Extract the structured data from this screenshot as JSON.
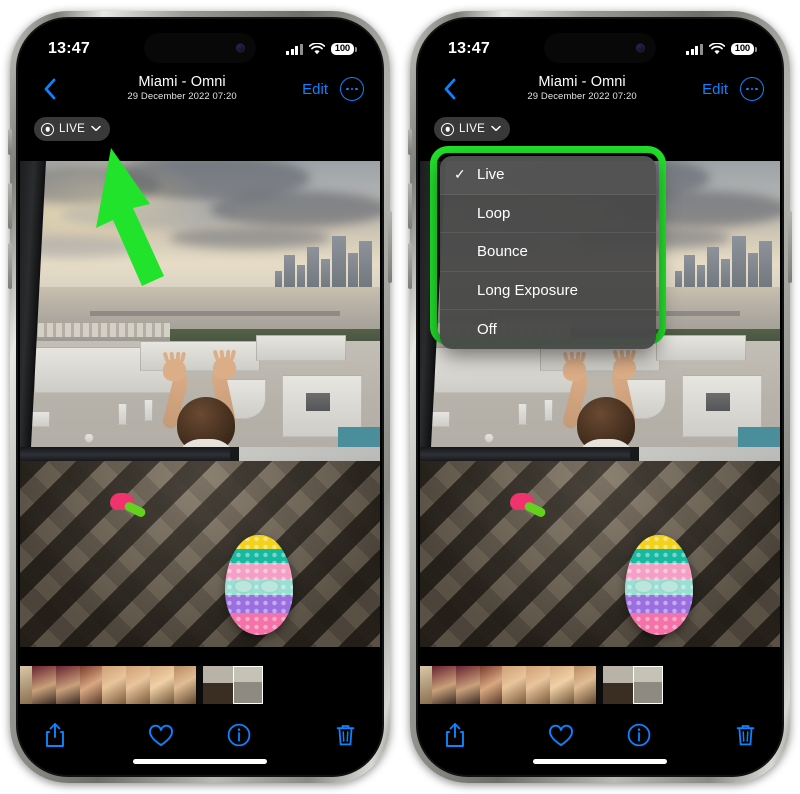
{
  "meta": {
    "description": "Two iPhone screenshots of the Photos app showing a Live Photo with the LIVE effects menu closed (left) and open (right)",
    "accent_blue": "#0a84ff",
    "highlight_green": "#22e32b",
    "menu_background": "#484848"
  },
  "phones": [
    {
      "id": "left",
      "status_bar": {
        "time": "13:47",
        "signal_icon": "cellular-bars-icon",
        "wifi_icon": "wifi-icon",
        "battery": "100"
      },
      "nav": {
        "back_icon": "chevron-left-icon",
        "title": "Miami - Omni",
        "subtitle": "29 December 2022  07:20",
        "edit_label": "Edit",
        "more_icon": "ellipsis-circle-icon"
      },
      "live_badge": {
        "icon": "live-photo-icon",
        "label": "LIVE",
        "chevron": "chevron-down-icon"
      },
      "annotation": {
        "type": "green-arrow",
        "color": "#22e32b",
        "points_to": "live-badge"
      },
      "menu_open": false,
      "toolbar": [
        {
          "name": "share-button",
          "icon": "share-icon"
        },
        {
          "name": "favorite-button",
          "icon": "heart-icon"
        },
        {
          "name": "info-button",
          "icon": "info-circle-icon"
        },
        {
          "name": "delete-button",
          "icon": "trash-icon"
        }
      ]
    },
    {
      "id": "right",
      "status_bar": {
        "time": "13:47",
        "signal_icon": "cellular-bars-icon",
        "wifi_icon": "wifi-icon",
        "battery": "100"
      },
      "nav": {
        "back_icon": "chevron-left-icon",
        "title": "Miami - Omni",
        "subtitle": "29 December 2022  07:20",
        "edit_label": "Edit",
        "more_icon": "ellipsis-circle-icon"
      },
      "live_badge": {
        "icon": "live-photo-icon",
        "label": "LIVE",
        "chevron": "chevron-down-icon"
      },
      "menu_open": true,
      "menu": {
        "highlighted": true,
        "items": [
          {
            "label": "Live",
            "checked": true
          },
          {
            "label": "Loop",
            "checked": false
          },
          {
            "label": "Bounce",
            "checked": false
          },
          {
            "label": "Long Exposure",
            "checked": false
          },
          {
            "label": "Off",
            "checked": false
          }
        ]
      },
      "toolbar": [
        {
          "name": "share-button",
          "icon": "share-icon"
        },
        {
          "name": "favorite-button",
          "icon": "heart-icon"
        },
        {
          "name": "info-button",
          "icon": "info-circle-icon"
        },
        {
          "name": "delete-button",
          "icon": "trash-icon"
        }
      ]
    }
  ],
  "photo": {
    "scene": "Toddler in floral dress standing at a hotel window looking out over Miami rooftops and bay at sunrise, with a rainbow pop-it toy and a small pink toy on a patterned carpet"
  }
}
